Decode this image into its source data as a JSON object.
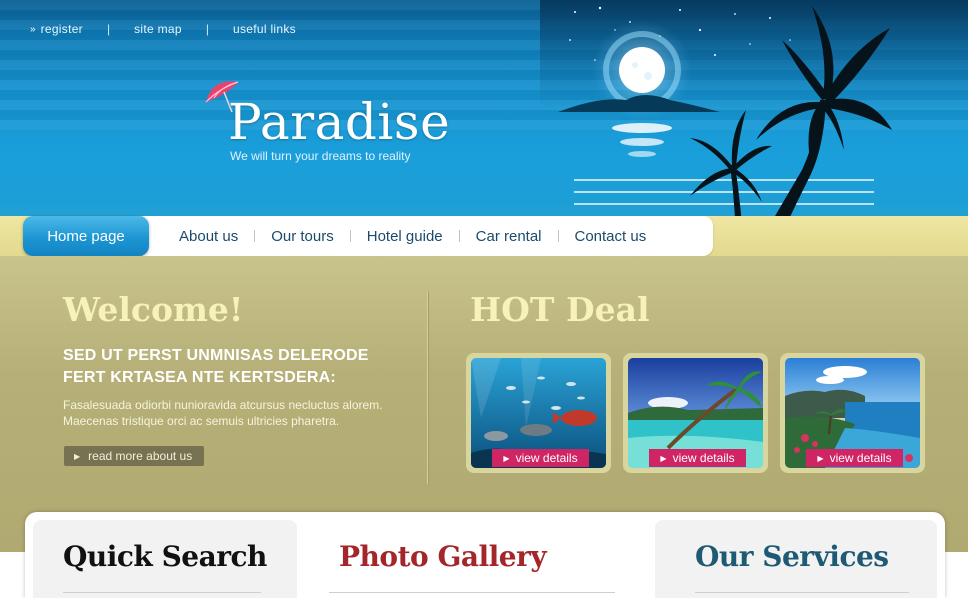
{
  "top_links": [
    "register",
    "site map",
    "useful links"
  ],
  "logo": {
    "title": "Paradise",
    "tagline": "We will turn your dreams to reality"
  },
  "nav": {
    "home": "Home page",
    "items": [
      "About us",
      "Our tours",
      "Hotel guide",
      "Car rental",
      "Contact us"
    ]
  },
  "welcome": {
    "title": "Welcome!",
    "heading": "SED UT PERST UNMNISAS DELERODE FERT KRTASEA NTE KERTSDERA:",
    "text": "Fasalesuada odiorbi nunioravida atcursus necluctus alorem. Maecenas tristique orci ac semuis ultricies pharetra.",
    "button": "read more about us"
  },
  "hot_deal": {
    "title": "HOT Deal",
    "items": [
      {
        "label": "view details",
        "icon": "underwater-fish-photo"
      },
      {
        "label": "view details",
        "icon": "palm-beach-photo"
      },
      {
        "label": "view details",
        "icon": "tropical-coast-photo"
      }
    ]
  },
  "panels": {
    "quick_search": "Quick Search",
    "photo_gallery": "Photo Gallery",
    "our_services": "Our Services"
  },
  "colors": {
    "nav_active": "#1d96d4",
    "accent_pink": "#d02564",
    "panel_red": "#a3262b",
    "panel_teal": "#1e5a73",
    "olive": "#b6b078"
  }
}
